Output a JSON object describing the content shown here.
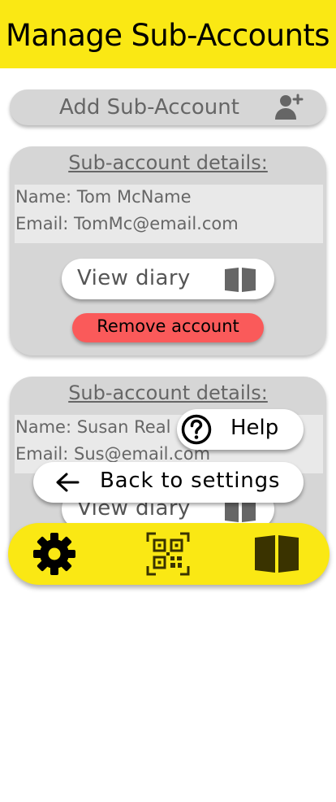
{
  "header": {
    "title": "Manage Sub-Accounts"
  },
  "add_sub_account": {
    "label": "Add Sub-Account",
    "icon": "person-add-icon"
  },
  "accounts": [
    {
      "section_title": "Sub-account details:",
      "name_line": "Name: Tom McName",
      "email_line": "Email: TomMc@email.com",
      "view_diary_label": "View diary",
      "remove_label": "Remove account"
    },
    {
      "section_title": "Sub-account details:",
      "name_line": "Name: Susan Real",
      "email_line": "Email: Sus@email.com",
      "view_diary_label": "View diary"
    }
  ],
  "help": {
    "label": "Help",
    "icon": "help-circle-icon"
  },
  "back": {
    "label": "Back to settings",
    "icon": "arrow-left-icon"
  },
  "bottom_nav": {
    "items": [
      {
        "icon": "gear-icon"
      },
      {
        "icon": "qr-code-icon"
      },
      {
        "icon": "book-icon"
      }
    ]
  },
  "colors": {
    "accent_yellow": "#fae814",
    "card_gray": "#d6d6d6",
    "info_gray": "#e9e9e9",
    "danger_red": "#fa5a5a",
    "text_gray": "#666666"
  }
}
